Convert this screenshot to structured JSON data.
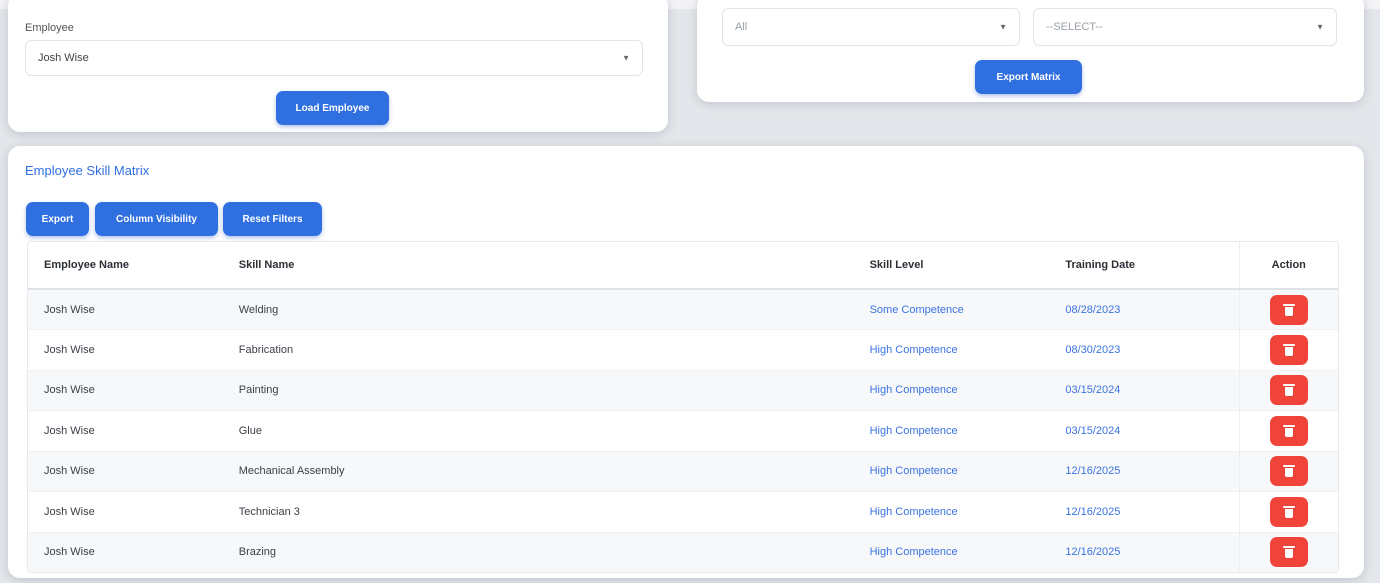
{
  "employee_panel": {
    "label": "Employee",
    "selected": "Josh Wise",
    "load_button": "Load Employee"
  },
  "export_panel": {
    "filter1_selected": "All",
    "filter2_selected": "--SELECT--",
    "export_button": "Export Matrix"
  },
  "matrix": {
    "title": "Employee Skill Matrix",
    "toolbar": {
      "export": "Export",
      "column_visibility": "Column Visibility",
      "reset_filters": "Reset Filters"
    },
    "columns": [
      "Employee Name",
      "Skill Name",
      "Skill Level",
      "Training Date",
      "Action"
    ],
    "rows": [
      {
        "employee": "Josh Wise",
        "skill": "Welding",
        "level": "Some Competence",
        "date": "08/28/2023"
      },
      {
        "employee": "Josh Wise",
        "skill": "Fabrication",
        "level": "High Competence",
        "date": "08/30/2023"
      },
      {
        "employee": "Josh Wise",
        "skill": "Painting",
        "level": "High Competence",
        "date": "03/15/2024"
      },
      {
        "employee": "Josh Wise",
        "skill": "Glue",
        "level": "High Competence",
        "date": "03/15/2024"
      },
      {
        "employee": "Josh Wise",
        "skill": "Mechanical Assembly",
        "level": "High Competence",
        "date": "12/16/2025"
      },
      {
        "employee": "Josh Wise",
        "skill": "Technician 3",
        "level": "High Competence",
        "date": "12/16/2025"
      },
      {
        "employee": "Josh Wise",
        "skill": "Brazing",
        "level": "High Competence",
        "date": "12/16/2025"
      }
    ]
  },
  "colors": {
    "primary": "#2f6fe0",
    "danger": "#f0443a",
    "link": "#3a73e0"
  },
  "icons": {
    "delete": "trash-icon",
    "dropdown": "chevron-down-icon"
  }
}
